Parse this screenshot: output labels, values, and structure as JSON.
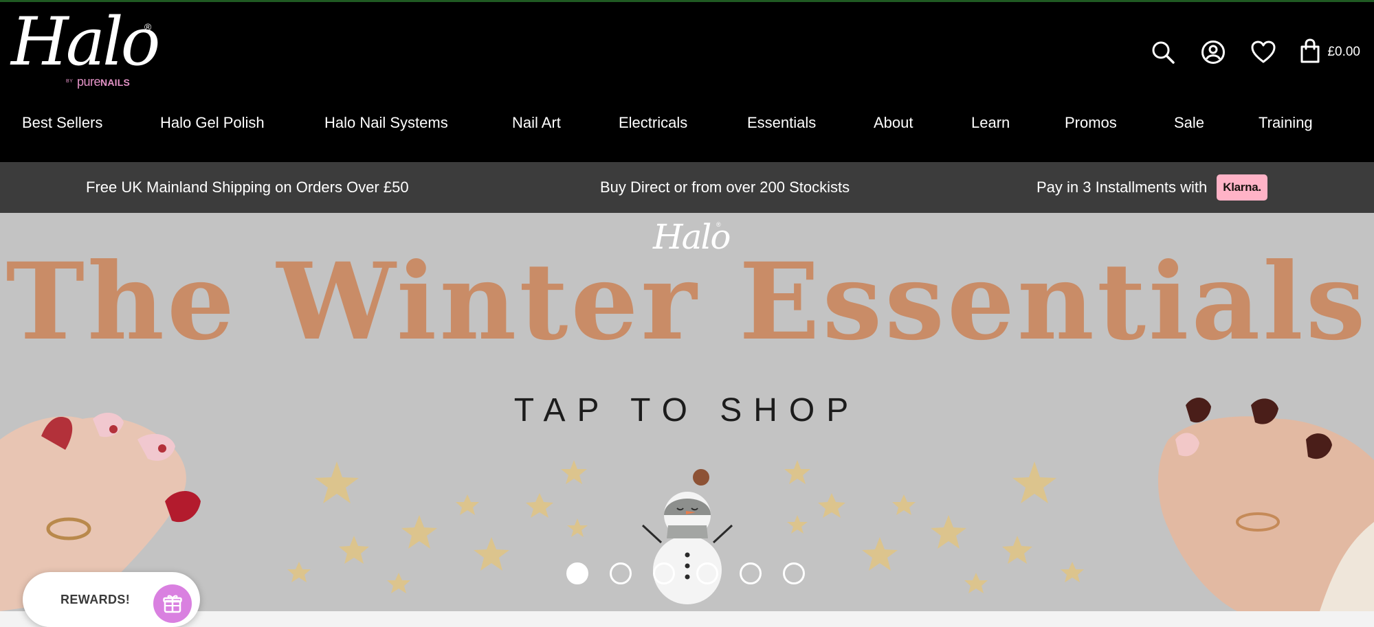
{
  "brand": {
    "logo_script": "Halo",
    "logo_by": "BY",
    "logo_sub_pure": "pure",
    "logo_sub_nails": "NAILS",
    "registered_mark": "®"
  },
  "header_icons": [
    "search-icon",
    "account-icon",
    "heart-icon",
    "bag-icon"
  ],
  "cart": {
    "amount": "£0.00"
  },
  "nav": {
    "items": [
      {
        "label": "Best Sellers"
      },
      {
        "label": "Halo Gel Polish"
      },
      {
        "label": "Halo Nail Systems"
      },
      {
        "label": "Nail Art"
      },
      {
        "label": "Electricals"
      },
      {
        "label": "Essentials"
      },
      {
        "label": "About"
      },
      {
        "label": "Learn"
      },
      {
        "label": "Promos"
      },
      {
        "label": "Sale"
      },
      {
        "label": "Training"
      }
    ]
  },
  "promo_bar": {
    "shipping": "Free UK Mainland Shipping on Orders Over £50",
    "stockists": "Buy Direct or from over 200 Stockists",
    "installments": "Pay in 3 Installments with",
    "klarna_badge": "Klarna."
  },
  "hero": {
    "logo": "Halo",
    "logo_reg": "®",
    "title": "The Winter Essentials",
    "cta": "TAP TO SHOP",
    "slide_count": 6,
    "active_slide": 1
  },
  "rewards": {
    "label": "REWARDS!",
    "icon": "gift-icon"
  },
  "colors": {
    "header_bg": "#000000",
    "promo_bar_bg": "#3c3c3c",
    "hero_bg": "#c3c3c3",
    "hero_title": "#c98c67",
    "klarna_pink": "#ffb3c7",
    "rewards_purple": "#d980e0",
    "logo_pink": "#e493c7"
  }
}
